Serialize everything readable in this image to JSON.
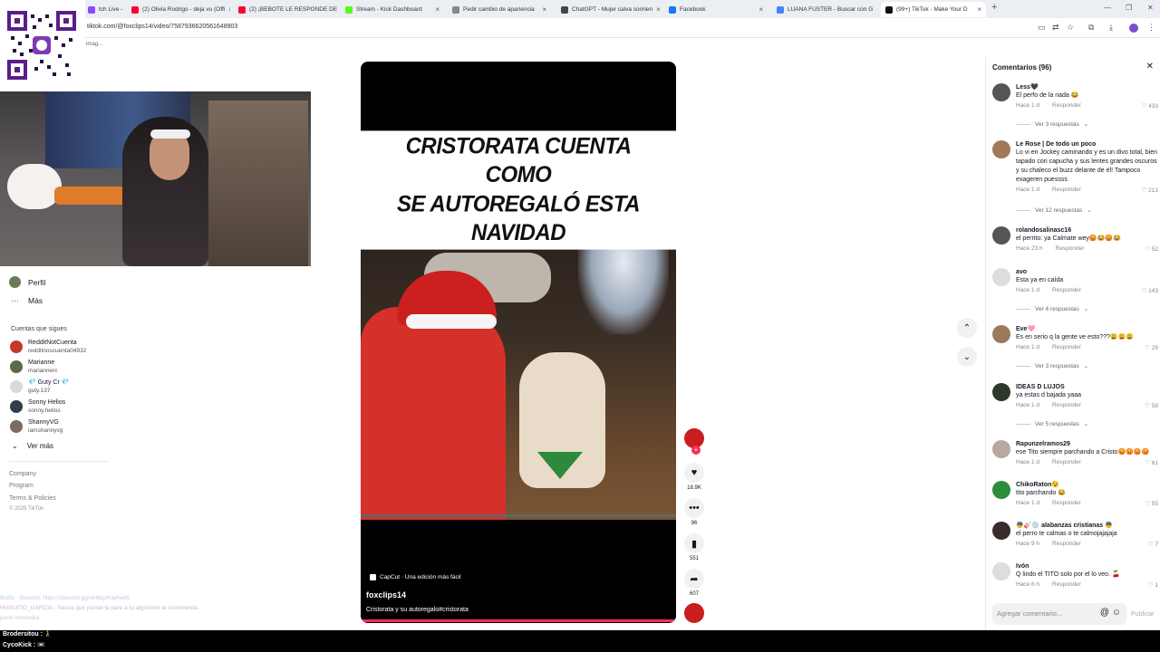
{
  "browser": {
    "tabs": [
      {
        "title": "tch Live -",
        "color": "#9147ff"
      },
      {
        "title": "(2) Olivia Rodrigo - deja vu (Offi",
        "color": "#ff0033"
      },
      {
        "title": "(2) ¡BEBOTE LE RESPONDE DE",
        "color": "#ff0033"
      },
      {
        "title": "Stream - Kick Dashboard",
        "color": "#53fc18"
      },
      {
        "title": "Pedir cambio de apariencia",
        "color": "#888888"
      },
      {
        "title": "ChatGPT - Mujer calva sonrien",
        "color": "#444444"
      },
      {
        "title": "Facebook",
        "color": "#1877f2"
      },
      {
        "title": "LUANA FUSTER - Buscar con G",
        "color": "#4285f4"
      },
      {
        "title": "(99+) TikTok - Make Your D",
        "color": "#111111"
      }
    ],
    "new_tab": "+",
    "url": "tiktok.com/@foxclips14/video/7587936620561648903",
    "bookmark_hint": "imag..."
  },
  "sidebar": {
    "nav": [
      {
        "label": "Perfil"
      },
      {
        "label": "Más"
      }
    ],
    "following_heading": "Cuentas que sigues",
    "following": [
      {
        "name": "RedditNotCuenta",
        "user": "redditnoscuenta04932",
        "color": "#c0392b"
      },
      {
        "name": "Marianne",
        "user": "mariannerc",
        "color": "#5b6b4a"
      },
      {
        "name": "💎 Guty Cr 💎",
        "user": "guty.137",
        "color": "#d9d9d9"
      },
      {
        "name": "Sonny Helios",
        "user": "sonny.helios",
        "color": "#2c3e50"
      },
      {
        "name": "ShannyVG",
        "user": "iamshannyvg",
        "color": "#7d6b5d"
      }
    ],
    "see_more": "Ver más",
    "footer": [
      "Company",
      "Program",
      "Terms & Policies"
    ],
    "copyright": "© 2025 TikTok"
  },
  "stream_chat": [
    {
      "text": "Botfix : Discord: https://discord.gg/vet6tp/Kiq/kek5"
    },
    {
      "text": "HUGUITO_GARCIA : Xesca que ponse la pare a tu algoritmo te recomenda"
    },
    {
      "text": "pone lonverdra"
    },
    {
      "text": "Brodersitou : 🧎"
    },
    {
      "text": "CycoKick : 📼"
    }
  ],
  "video": {
    "headline_line1": "CRISTORATA CUENTA COMO",
    "headline_line2": "SE AUTOREGALÓ ESTA NAVIDAD",
    "capcut": "CapCut · Una edición más fácil",
    "username": "foxclips14",
    "description": "Cristorata y su autoregalo#cristorata"
  },
  "actions": {
    "likes": "18.9K",
    "comments": "96",
    "saves": "551",
    "shares": "607"
  },
  "comments_panel": {
    "title": "Comentarios (96)",
    "reply_label": "Responder",
    "input_placeholder": "Agregar comentario...",
    "publish": "Publicar",
    "items": [
      {
        "name": "Less🖤",
        "text": "El perfo de la nada 😂",
        "time": "Hace 1 d",
        "likes": "433",
        "replies": "Ver 3 respuestas",
        "color": "#555555"
      },
      {
        "name": "Le Rose | De todo un poco",
        "text": "Lo vi en Jockey caminando y es un divo total, bien tapado con capucha y sus lentes grandes oscuros y su chaleco el buzz delante de él! Tampoco exageren puessss",
        "time": "Hace 1 d",
        "likes": "213",
        "replies": "Ver 12 respuestas",
        "color": "#a0785a"
      },
      {
        "name": "rolandosalinasc16",
        "text": "el perrito: ya Calmate wey😡😂😡😂",
        "time": "Hace 23 h",
        "likes": "52",
        "replies": "",
        "color": "#555555"
      },
      {
        "name": "avo",
        "text": "Esta ya en caída",
        "time": "Hace 1 d",
        "likes": "143",
        "replies": "Ver 4 respuestas",
        "color": "#dddddd"
      },
      {
        "name": "Eve🩷",
        "text": "Es en serio q la gente ve esto???😩😩😩",
        "time": "Hace 1 d",
        "likes": "29",
        "replies": "Ver 3 respuestas",
        "color": "#9a7a5a"
      },
      {
        "name": "IDEAS D LUJOS",
        "text": "ya estas d bajada yaaa",
        "time": "Hace 1 d",
        "likes": "58",
        "replies": "Ver 5 respuestas",
        "color": "#2d3a2a"
      },
      {
        "name": "Rapunzelramos29",
        "text": "ese Tito siempre parchando a Cristo😡😡😡😡",
        "time": "Hace 1 d",
        "likes": "61",
        "replies": "",
        "color": "#b8a8a0"
      },
      {
        "name": "ChikoRaton😉",
        "text": "tito parchando 😂",
        "time": "Hace 1 d",
        "likes": "55",
        "replies": "",
        "color": "#2e8b3a"
      },
      {
        "name": "👼🎸💿 alabanzas cristianas 👼",
        "text": "el perro te calmas o te calmojajajaja",
        "time": "Hace 9 h",
        "likes": "7",
        "replies": "",
        "color": "#3a2a2a"
      },
      {
        "name": "Ivón",
        "text": "Q lindo el TITO solo por el lo veo. 🍒",
        "time": "Hace 6 h",
        "likes": "1",
        "replies": "",
        "color": "#dddddd"
      }
    ]
  },
  "colors": {
    "accent": "#fe2c55",
    "tiktok_text": "#161823"
  }
}
